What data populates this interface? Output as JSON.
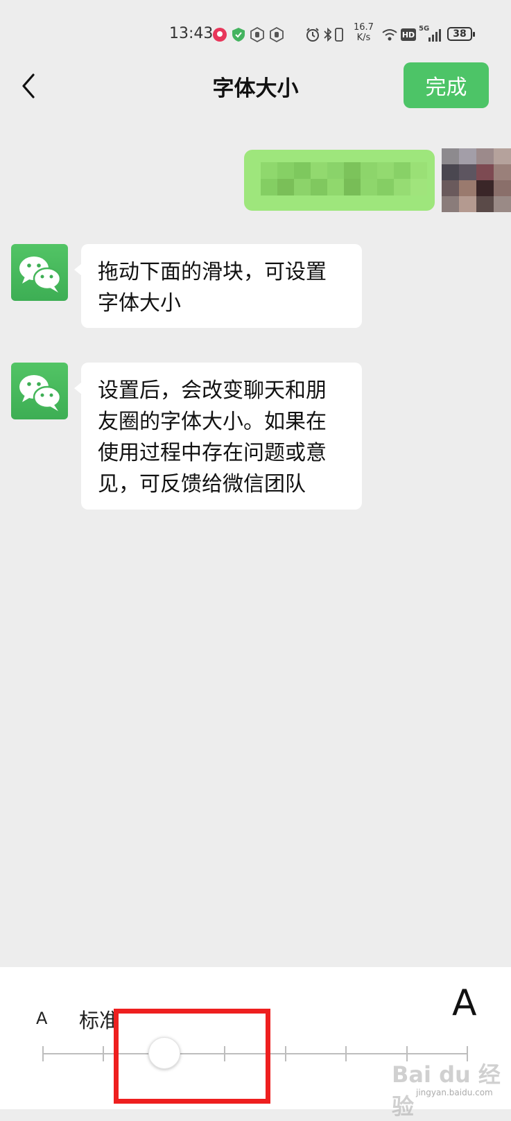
{
  "status_bar": {
    "time": "13:43",
    "net_speed_value": "16.7",
    "net_speed_unit": "K/s",
    "hd_label": "HD",
    "signal_label": "5G",
    "battery": "38"
  },
  "header": {
    "title": "字体大小",
    "done_label": "完成"
  },
  "messages": [
    {
      "text": "拖动下面的滑块，可设置字体大小"
    },
    {
      "text": "设置后，会改变聊天和朋友圈的字体大小。如果在使用过程中存在问题或意见，可反馈给微信团队"
    }
  ],
  "font_panel": {
    "small_glyph": "A",
    "large_glyph": "A",
    "size_name": "标准",
    "ticks": 8,
    "selected_index": 2
  },
  "watermark": {
    "text": "Bai du 经验",
    "sub": "jingyan.baidu.com"
  },
  "colors": {
    "accent": "#4dc467",
    "background": "#ededed",
    "highlight": "#ee1f1f"
  }
}
